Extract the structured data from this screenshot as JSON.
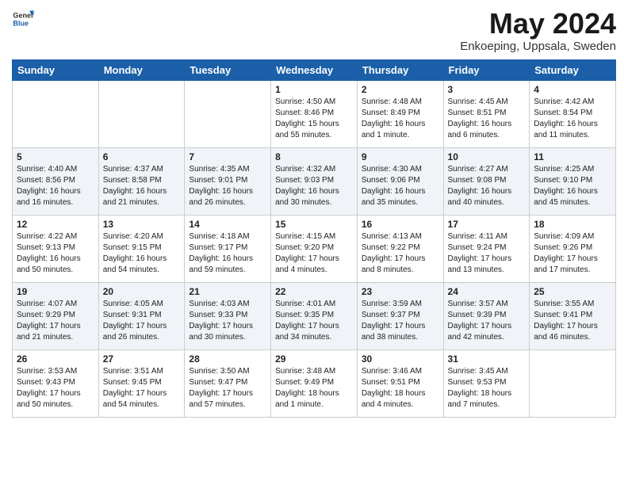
{
  "header": {
    "logo_general": "General",
    "logo_blue": "Blue",
    "month_year": "May 2024",
    "location": "Enkoeping, Uppsala, Sweden"
  },
  "weekdays": [
    "Sunday",
    "Monday",
    "Tuesday",
    "Wednesday",
    "Thursday",
    "Friday",
    "Saturday"
  ],
  "weeks": [
    [
      {
        "day": "",
        "info": ""
      },
      {
        "day": "",
        "info": ""
      },
      {
        "day": "",
        "info": ""
      },
      {
        "day": "1",
        "info": "Sunrise: 4:50 AM\nSunset: 8:46 PM\nDaylight: 15 hours\nand 55 minutes."
      },
      {
        "day": "2",
        "info": "Sunrise: 4:48 AM\nSunset: 8:49 PM\nDaylight: 16 hours\nand 1 minute."
      },
      {
        "day": "3",
        "info": "Sunrise: 4:45 AM\nSunset: 8:51 PM\nDaylight: 16 hours\nand 6 minutes."
      },
      {
        "day": "4",
        "info": "Sunrise: 4:42 AM\nSunset: 8:54 PM\nDaylight: 16 hours\nand 11 minutes."
      }
    ],
    [
      {
        "day": "5",
        "info": "Sunrise: 4:40 AM\nSunset: 8:56 PM\nDaylight: 16 hours\nand 16 minutes."
      },
      {
        "day": "6",
        "info": "Sunrise: 4:37 AM\nSunset: 8:58 PM\nDaylight: 16 hours\nand 21 minutes."
      },
      {
        "day": "7",
        "info": "Sunrise: 4:35 AM\nSunset: 9:01 PM\nDaylight: 16 hours\nand 26 minutes."
      },
      {
        "day": "8",
        "info": "Sunrise: 4:32 AM\nSunset: 9:03 PM\nDaylight: 16 hours\nand 30 minutes."
      },
      {
        "day": "9",
        "info": "Sunrise: 4:30 AM\nSunset: 9:06 PM\nDaylight: 16 hours\nand 35 minutes."
      },
      {
        "day": "10",
        "info": "Sunrise: 4:27 AM\nSunset: 9:08 PM\nDaylight: 16 hours\nand 40 minutes."
      },
      {
        "day": "11",
        "info": "Sunrise: 4:25 AM\nSunset: 9:10 PM\nDaylight: 16 hours\nand 45 minutes."
      }
    ],
    [
      {
        "day": "12",
        "info": "Sunrise: 4:22 AM\nSunset: 9:13 PM\nDaylight: 16 hours\nand 50 minutes."
      },
      {
        "day": "13",
        "info": "Sunrise: 4:20 AM\nSunset: 9:15 PM\nDaylight: 16 hours\nand 54 minutes."
      },
      {
        "day": "14",
        "info": "Sunrise: 4:18 AM\nSunset: 9:17 PM\nDaylight: 16 hours\nand 59 minutes."
      },
      {
        "day": "15",
        "info": "Sunrise: 4:15 AM\nSunset: 9:20 PM\nDaylight: 17 hours\nand 4 minutes."
      },
      {
        "day": "16",
        "info": "Sunrise: 4:13 AM\nSunset: 9:22 PM\nDaylight: 17 hours\nand 8 minutes."
      },
      {
        "day": "17",
        "info": "Sunrise: 4:11 AM\nSunset: 9:24 PM\nDaylight: 17 hours\nand 13 minutes."
      },
      {
        "day": "18",
        "info": "Sunrise: 4:09 AM\nSunset: 9:26 PM\nDaylight: 17 hours\nand 17 minutes."
      }
    ],
    [
      {
        "day": "19",
        "info": "Sunrise: 4:07 AM\nSunset: 9:29 PM\nDaylight: 17 hours\nand 21 minutes."
      },
      {
        "day": "20",
        "info": "Sunrise: 4:05 AM\nSunset: 9:31 PM\nDaylight: 17 hours\nand 26 minutes."
      },
      {
        "day": "21",
        "info": "Sunrise: 4:03 AM\nSunset: 9:33 PM\nDaylight: 17 hours\nand 30 minutes."
      },
      {
        "day": "22",
        "info": "Sunrise: 4:01 AM\nSunset: 9:35 PM\nDaylight: 17 hours\nand 34 minutes."
      },
      {
        "day": "23",
        "info": "Sunrise: 3:59 AM\nSunset: 9:37 PM\nDaylight: 17 hours\nand 38 minutes."
      },
      {
        "day": "24",
        "info": "Sunrise: 3:57 AM\nSunset: 9:39 PM\nDaylight: 17 hours\nand 42 minutes."
      },
      {
        "day": "25",
        "info": "Sunrise: 3:55 AM\nSunset: 9:41 PM\nDaylight: 17 hours\nand 46 minutes."
      }
    ],
    [
      {
        "day": "26",
        "info": "Sunrise: 3:53 AM\nSunset: 9:43 PM\nDaylight: 17 hours\nand 50 minutes."
      },
      {
        "day": "27",
        "info": "Sunrise: 3:51 AM\nSunset: 9:45 PM\nDaylight: 17 hours\nand 54 minutes."
      },
      {
        "day": "28",
        "info": "Sunrise: 3:50 AM\nSunset: 9:47 PM\nDaylight: 17 hours\nand 57 minutes."
      },
      {
        "day": "29",
        "info": "Sunrise: 3:48 AM\nSunset: 9:49 PM\nDaylight: 18 hours\nand 1 minute."
      },
      {
        "day": "30",
        "info": "Sunrise: 3:46 AM\nSunset: 9:51 PM\nDaylight: 18 hours\nand 4 minutes."
      },
      {
        "day": "31",
        "info": "Sunrise: 3:45 AM\nSunset: 9:53 PM\nDaylight: 18 hours\nand 7 minutes."
      },
      {
        "day": "",
        "info": ""
      }
    ]
  ]
}
